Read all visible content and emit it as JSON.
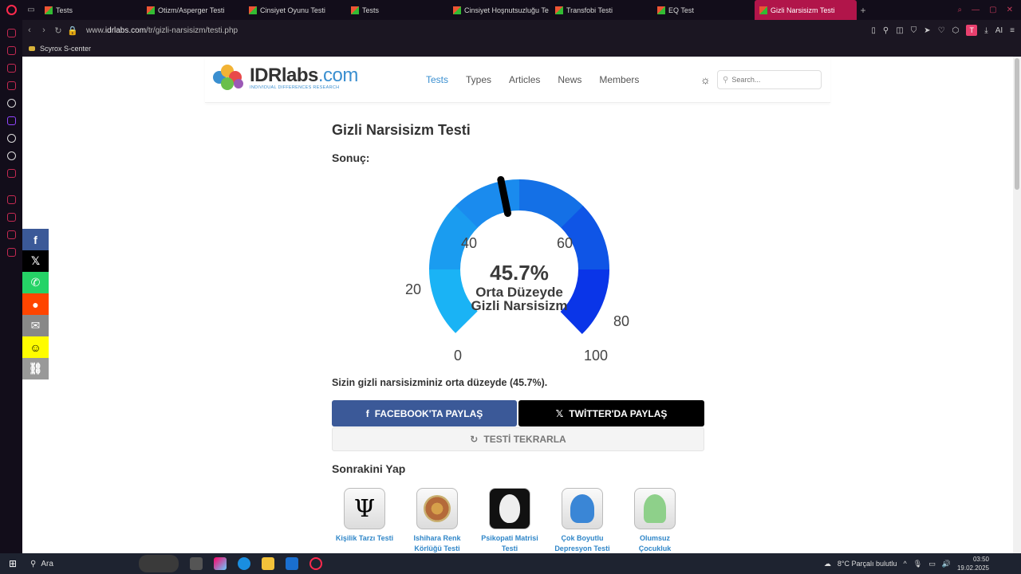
{
  "browser": {
    "tabs": [
      {
        "label": "Tests",
        "active": false
      },
      {
        "label": "Otizm/Asperger Testi",
        "active": false
      },
      {
        "label": "Cinsiyet Oyunu Testi",
        "active": false
      },
      {
        "label": "Tests",
        "active": false
      },
      {
        "label": "Cinsiyet Hoşnutsuzluğu Te",
        "active": false
      },
      {
        "label": "Transfobi Testi",
        "active": false
      },
      {
        "label": "EQ Test",
        "active": false
      },
      {
        "label": "Gizli Narsisizm Testi",
        "active": true
      }
    ],
    "url_prefix": "www.",
    "url_host": "idrlabs.com",
    "url_path": "/tr/gizli-narsisizm/testi.php",
    "bookmark": "Scyrox S-center",
    "ai_label": "AI",
    "avatar": "T"
  },
  "site": {
    "logo_main": "IDRlabs",
    "logo_suffix": ".com",
    "logo_sub": "INDIVIDUAL DIFFERENCES RESEARCH",
    "nav": [
      "Tests",
      "Types",
      "Articles",
      "News",
      "Members"
    ],
    "search_placeholder": "Search..."
  },
  "page": {
    "title": "Gizli Narsisizm Testi",
    "result_label": "Sonuç:",
    "gauge": {
      "value": 45.7,
      "percent_text": "45.7%",
      "line1": "Orta Düzeyde",
      "line2": "Gizli Narsisizm",
      "ticks": [
        "0",
        "20",
        "40",
        "60",
        "80",
        "100"
      ],
      "colors": [
        "#1ab3f5",
        "#1a9cf0",
        "#1a8bee",
        "#1470e6",
        "#0f55e6",
        "#0a35e8"
      ]
    },
    "result_sentence": "Sizin gizli narsisizminiz orta düzeyde (45.7%).",
    "btn_facebook": "FACEBOOK'TA PAYLAŞ",
    "btn_twitter": "TWİTTER'DA PAYLAŞ",
    "btn_retry": "TESTİ TEKRARLA",
    "next_title": "Sonrakini Yap",
    "next_tests": [
      {
        "label1": "Kişilik Tarzı Testi",
        "label2": "",
        "icon": "psi-icon"
      },
      {
        "label1": "Ishihara Renk",
        "label2": "Körlüğü Testi",
        "icon": "ishihara-icon"
      },
      {
        "label1": "Psikopati Matrisi",
        "label2": "Testi",
        "icon": "mask-icon"
      },
      {
        "label1": "Çok Boyutlu",
        "label2": "Depresyon Testi",
        "icon": "head-icon"
      },
      {
        "label1": "Olumsuz",
        "label2": "Çocukluk",
        "icon": "child-icon"
      }
    ]
  },
  "taskbar": {
    "search": "Ara",
    "weather": "8°C  Parçalı bulutlu",
    "time": "03:50",
    "date": "19.02.2025"
  }
}
